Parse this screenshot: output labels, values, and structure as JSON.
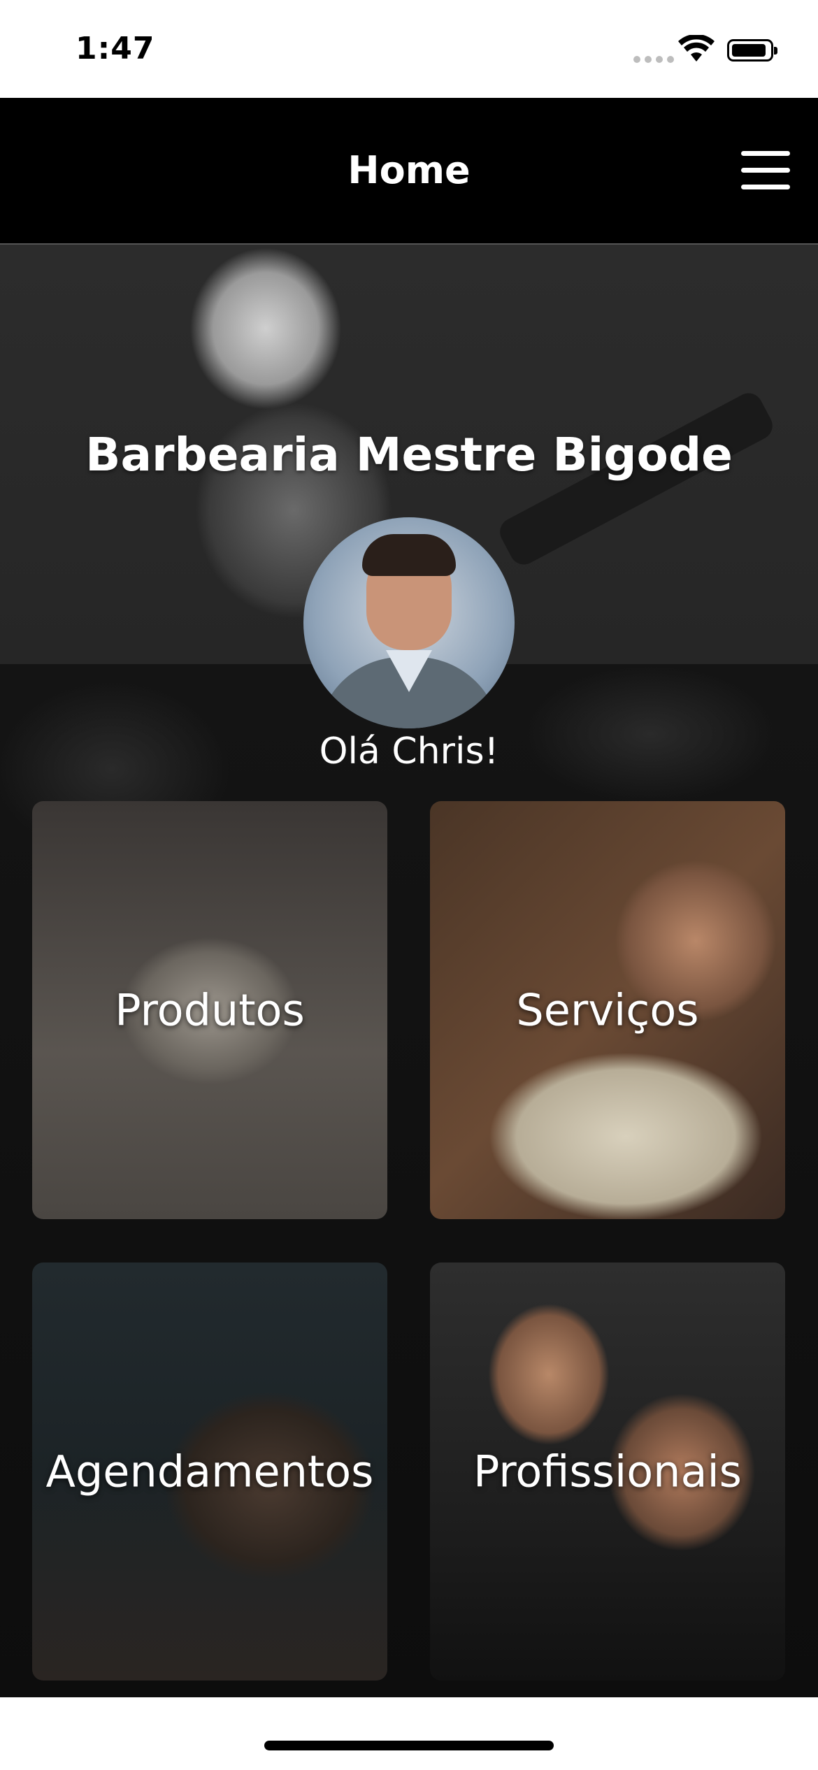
{
  "status_bar": {
    "time": "1:47",
    "icons": [
      "signal-icon",
      "wifi-icon",
      "battery-icon"
    ]
  },
  "nav": {
    "title": "Home",
    "menu_icon": "hamburger-menu-icon"
  },
  "hero": {
    "shop_name": "Barbearia Mestre Bigode"
  },
  "profile": {
    "greeting": "Olá Chris!"
  },
  "cards": [
    {
      "label": "Produtos"
    },
    {
      "label": "Serviços"
    },
    {
      "label": "Agendamentos"
    },
    {
      "label": "Profissionais"
    }
  ],
  "colors": {
    "background": "#000000",
    "text": "#ffffff",
    "status_bar": "#ffffff"
  }
}
